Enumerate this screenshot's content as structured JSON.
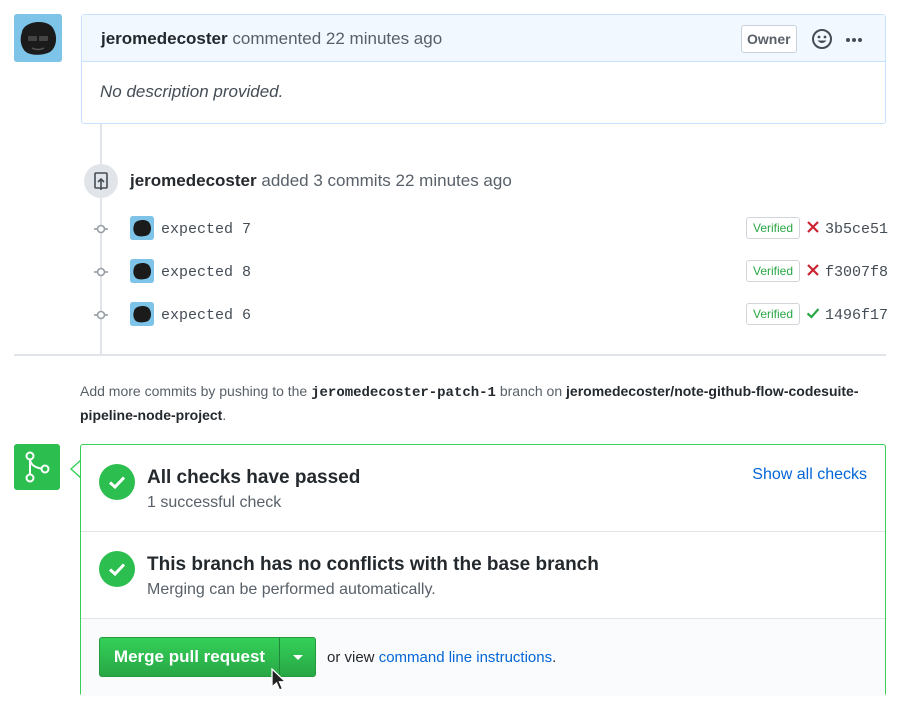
{
  "comment": {
    "author": "jeromedecoster",
    "action": "commented",
    "time": "22 minutes ago",
    "role_badge": "Owner",
    "body": "No description provided."
  },
  "push_event": {
    "author": "jeromedecoster",
    "action": "added 3 commits",
    "time": "22 minutes ago"
  },
  "commits": [
    {
      "message": "expected 7",
      "badge": "Verified",
      "status": "failure",
      "sha": "3b5ce51"
    },
    {
      "message": "expected 8",
      "badge": "Verified",
      "status": "failure",
      "sha": "f3007f8"
    },
    {
      "message": "expected 6",
      "badge": "Verified",
      "status": "success",
      "sha": "1496f17"
    }
  ],
  "help": {
    "prefix": "Add more commits by pushing to the",
    "branch": "jeromedecoster-patch-1",
    "middle": "branch on",
    "repo": "jeromedecoster/note-github-flow-codesuite-pipeline-node-project",
    "suffix": "."
  },
  "merge": {
    "checks_title": "All checks have passed",
    "checks_sub": "1 successful check",
    "show_checks": "Show all checks",
    "conflict_title": "This branch has no conflicts with the base branch",
    "conflict_sub": "Merging can be performed automatically.",
    "merge_button": "Merge pull request",
    "or_view": "or view",
    "cli_link": "command line instructions",
    "cli_suffix": "."
  },
  "colors": {
    "accent_green": "#2cbe4e",
    "link_blue": "#0366d6",
    "failure_red": "#cb2431",
    "success_green": "#28a745"
  },
  "icons": [
    "avatar",
    "smiley-icon",
    "kebab-icon",
    "repo-push-icon",
    "commit-node-icon",
    "x-icon",
    "check-icon",
    "git-merge-icon",
    "triangle-down-icon",
    "mouse-cursor-icon"
  ]
}
